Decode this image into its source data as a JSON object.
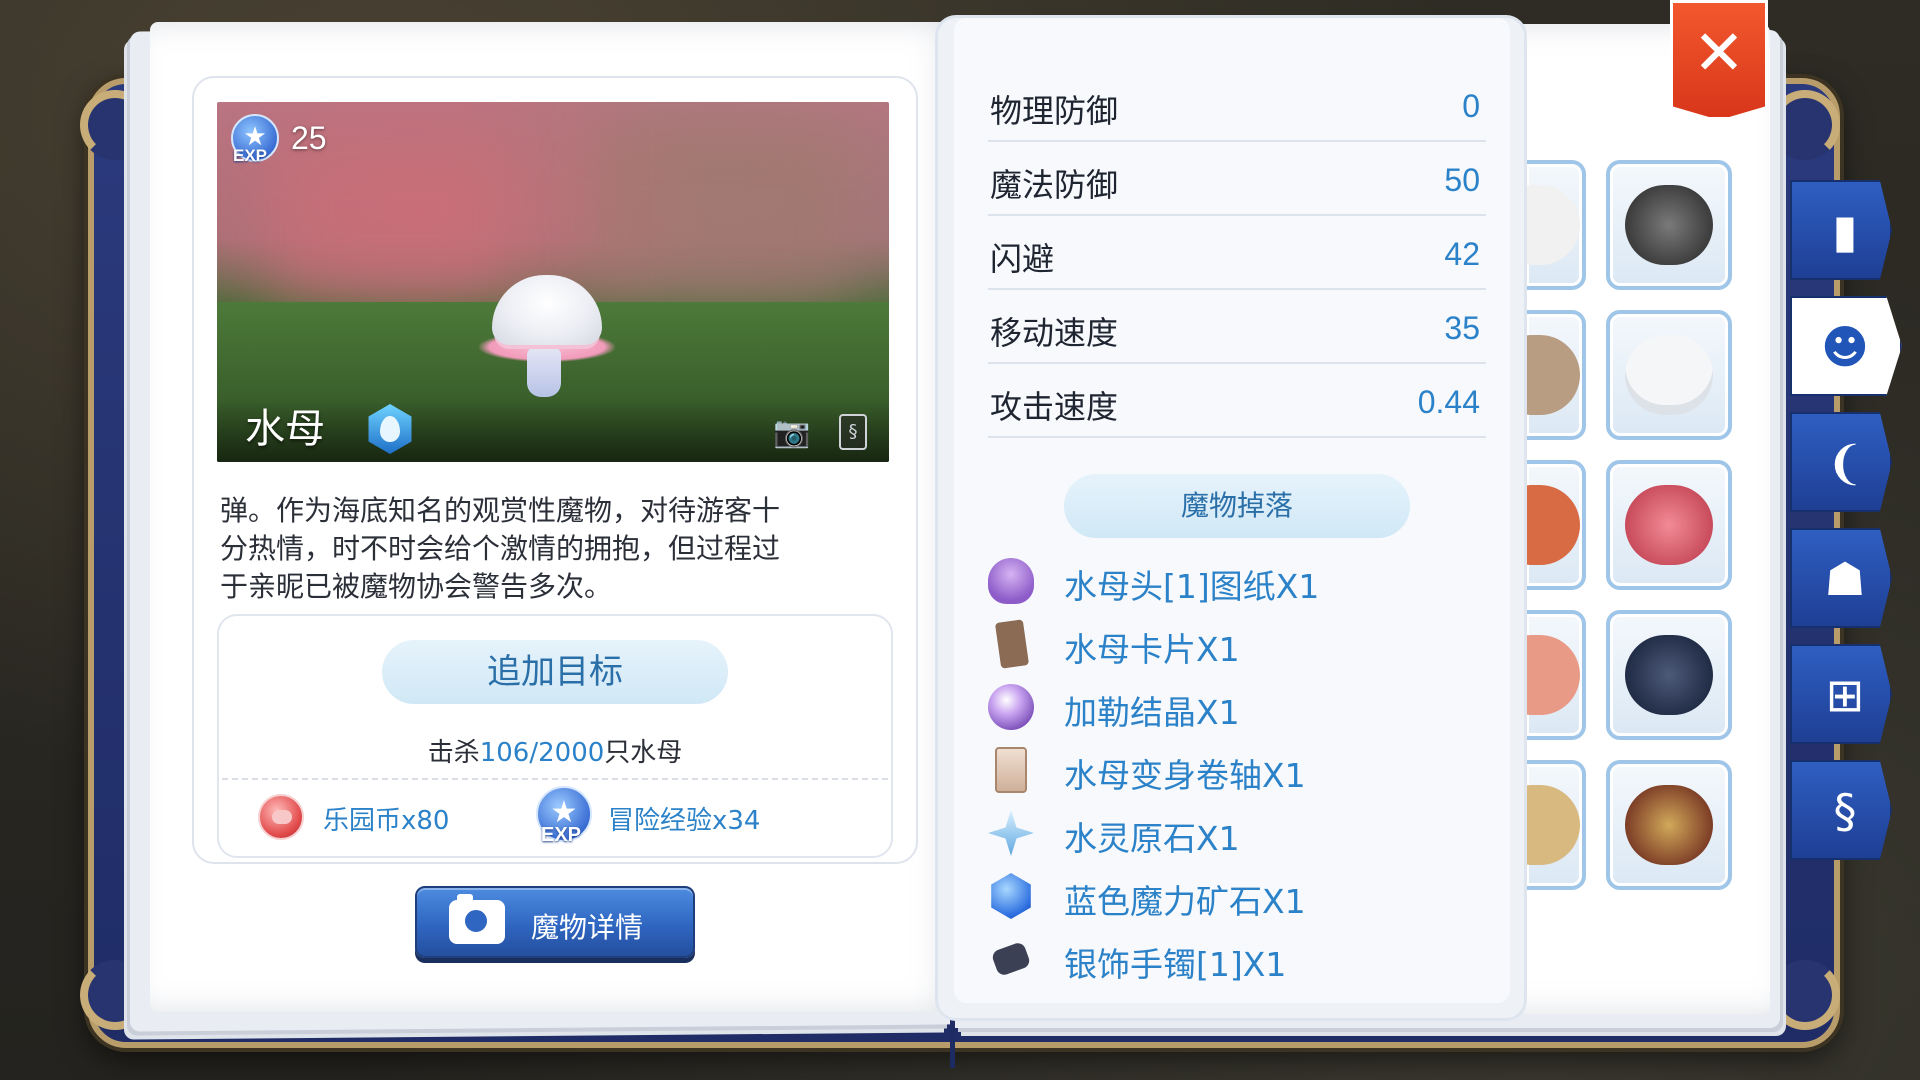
{
  "monster": {
    "exp_label": "EXP",
    "exp_value": "25",
    "name": "水母",
    "element_icon": "water-element-icon",
    "description_lines": [
      "弹。作为海底知名的观赏性魔物，对待游客十",
      "分热情，时不时会给个激情的拥抱，但过程过",
      "于亲昵已被魔物协会警告多次。"
    ]
  },
  "target": {
    "add_button_label": "追加目标",
    "kill_prefix": "击杀",
    "kill_count": "106/2000",
    "kill_suffix": "只水母",
    "rewards": [
      {
        "icon": "park-coin-icon",
        "label": "乐园币x80"
      },
      {
        "icon": "exp-icon",
        "badge": "EXP",
        "label": "冒险经验x34"
      }
    ]
  },
  "detail_button_label": "魔物详情",
  "stats": [
    {
      "name": "物理防御",
      "value": "0"
    },
    {
      "name": "魔法防御",
      "value": "50"
    },
    {
      "name": "闪避",
      "value": "42"
    },
    {
      "name": "移动速度",
      "value": "35"
    },
    {
      "name": "攻击速度",
      "value": "0.44"
    }
  ],
  "drops": {
    "header": "魔物掉落",
    "items": [
      {
        "icon": "jellyfish-head-icon",
        "label": "水母头[1]图纸X1"
      },
      {
        "icon": "card-icon",
        "label": "水母卡片X1"
      },
      {
        "icon": "crystal-orb-icon",
        "label": "加勒结晶X1"
      },
      {
        "icon": "scroll-icon",
        "label": "水母变身卷轴X1"
      },
      {
        "icon": "water-ore-icon",
        "label": "水灵原石X1"
      },
      {
        "icon": "blue-ore-icon",
        "label": "蓝色魔力矿石X1"
      },
      {
        "icon": "bracelet-icon",
        "label": "银饰手镯[1]X1"
      }
    ]
  },
  "close_label": "✕",
  "tabs": [
    {
      "icon": "book-icon",
      "glyph": "▮"
    },
    {
      "icon": "monster-face-icon",
      "glyph": "☻"
    },
    {
      "icon": "horn-icon",
      "glyph": "❨"
    },
    {
      "icon": "npc-bust-icon",
      "glyph": "☗"
    },
    {
      "icon": "open-book-icon",
      "glyph": "⊞"
    },
    {
      "icon": "card-tab-icon",
      "glyph": "§"
    }
  ],
  "colors": {
    "accent_blue": "#2b82c8",
    "button_blue": "#2f66c1",
    "close_red": "#e0401f",
    "frame_navy": "#1f2c66"
  }
}
